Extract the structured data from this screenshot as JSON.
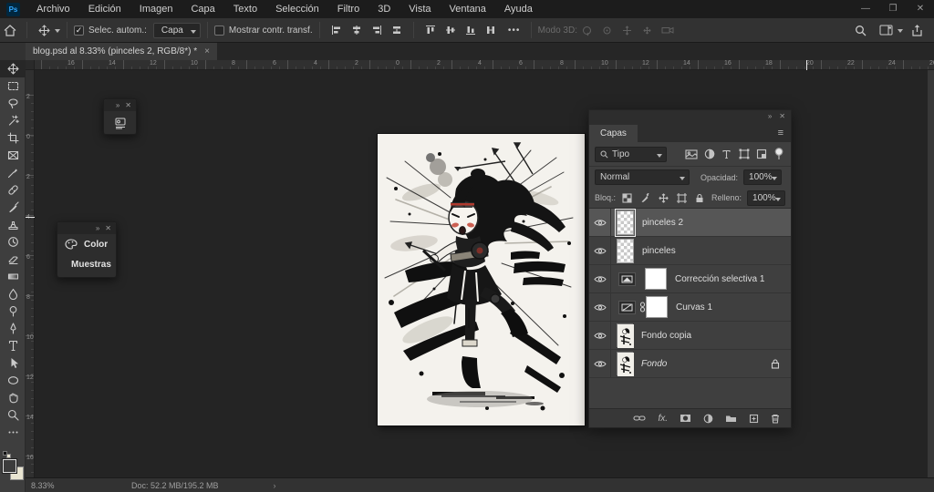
{
  "titlebar": {
    "app_icon": "Ps",
    "menus": [
      "Archivo",
      "Edición",
      "Imagen",
      "Capa",
      "Texto",
      "Selección",
      "Filtro",
      "3D",
      "Vista",
      "Ventana",
      "Ayuda"
    ],
    "minimize": "—",
    "restore": "❐",
    "close": "✕"
  },
  "options_bar": {
    "select_auto_label": "Selec. autom.:",
    "select_auto_checked": "✓",
    "select_auto_value": "Capa",
    "show_transform_label": "Mostrar contr. transf.",
    "more_label": "•••",
    "modo3d_label": "Modo 3D:"
  },
  "doc_tab": {
    "title": "blog.psd al 8.33% (pinceles 2, RGB/8*) *",
    "close": "×"
  },
  "rulers": {
    "horizontal": [
      "16",
      "14",
      "12",
      "10",
      "8",
      "6",
      "4",
      "2",
      "0",
      "2",
      "4",
      "6",
      "8",
      "10",
      "12",
      "14",
      "16",
      "18",
      "20",
      "22",
      "24",
      "26"
    ],
    "vertical": [
      "2",
      "0",
      "2",
      "4",
      "6",
      "8",
      "10",
      "12",
      "14",
      "16"
    ]
  },
  "tools": [
    "move",
    "rectangular-marquee",
    "lasso",
    "magic-wand",
    "crop",
    "frame",
    "eyedropper",
    "healing-brush",
    "brush",
    "clone-stamp",
    "history-brush",
    "eraser",
    "gradient",
    "smudge",
    "dodge",
    "pen",
    "type",
    "path-selection",
    "ellipse-shape",
    "hand",
    "zoom",
    "more-tools"
  ],
  "mini_panel": {
    "collapse": "»",
    "close": "✕"
  },
  "color_panel": {
    "collapse": "»",
    "close": "✕",
    "items": [
      {
        "label": "Color"
      },
      {
        "label": "Muestras"
      }
    ]
  },
  "layers_panel": {
    "collapse": "»",
    "close": "✕",
    "tab_label": "Capas",
    "menu_icon": "≡",
    "filter_value": "Tipo",
    "blend_mode": "Normal",
    "opacity_label": "Opacidad:",
    "opacity_value": "100%",
    "lock_label": "Bloq.:",
    "fill_label": "Relleno:",
    "fill_value": "100%",
    "layers": [
      {
        "name": "pinceles 2",
        "selected": true
      },
      {
        "name": "pinceles"
      },
      {
        "name": "Corrección selectiva 1"
      },
      {
        "name": "Curvas 1"
      },
      {
        "name": "Fondo copia"
      },
      {
        "name": "Fondo",
        "locked": true
      }
    ],
    "bottom_fx_label": "fx."
  },
  "status_bar": {
    "zoom": "8.33%",
    "doc": "Doc: 52.2 MB/195.2 MB",
    "arrow": "›"
  },
  "colors": {
    "accent_blue": "#31a8ff",
    "paper": "#f4f2ed",
    "fg_swatch": "#3c3c3c",
    "bg_swatch": "#e9e5d2"
  }
}
